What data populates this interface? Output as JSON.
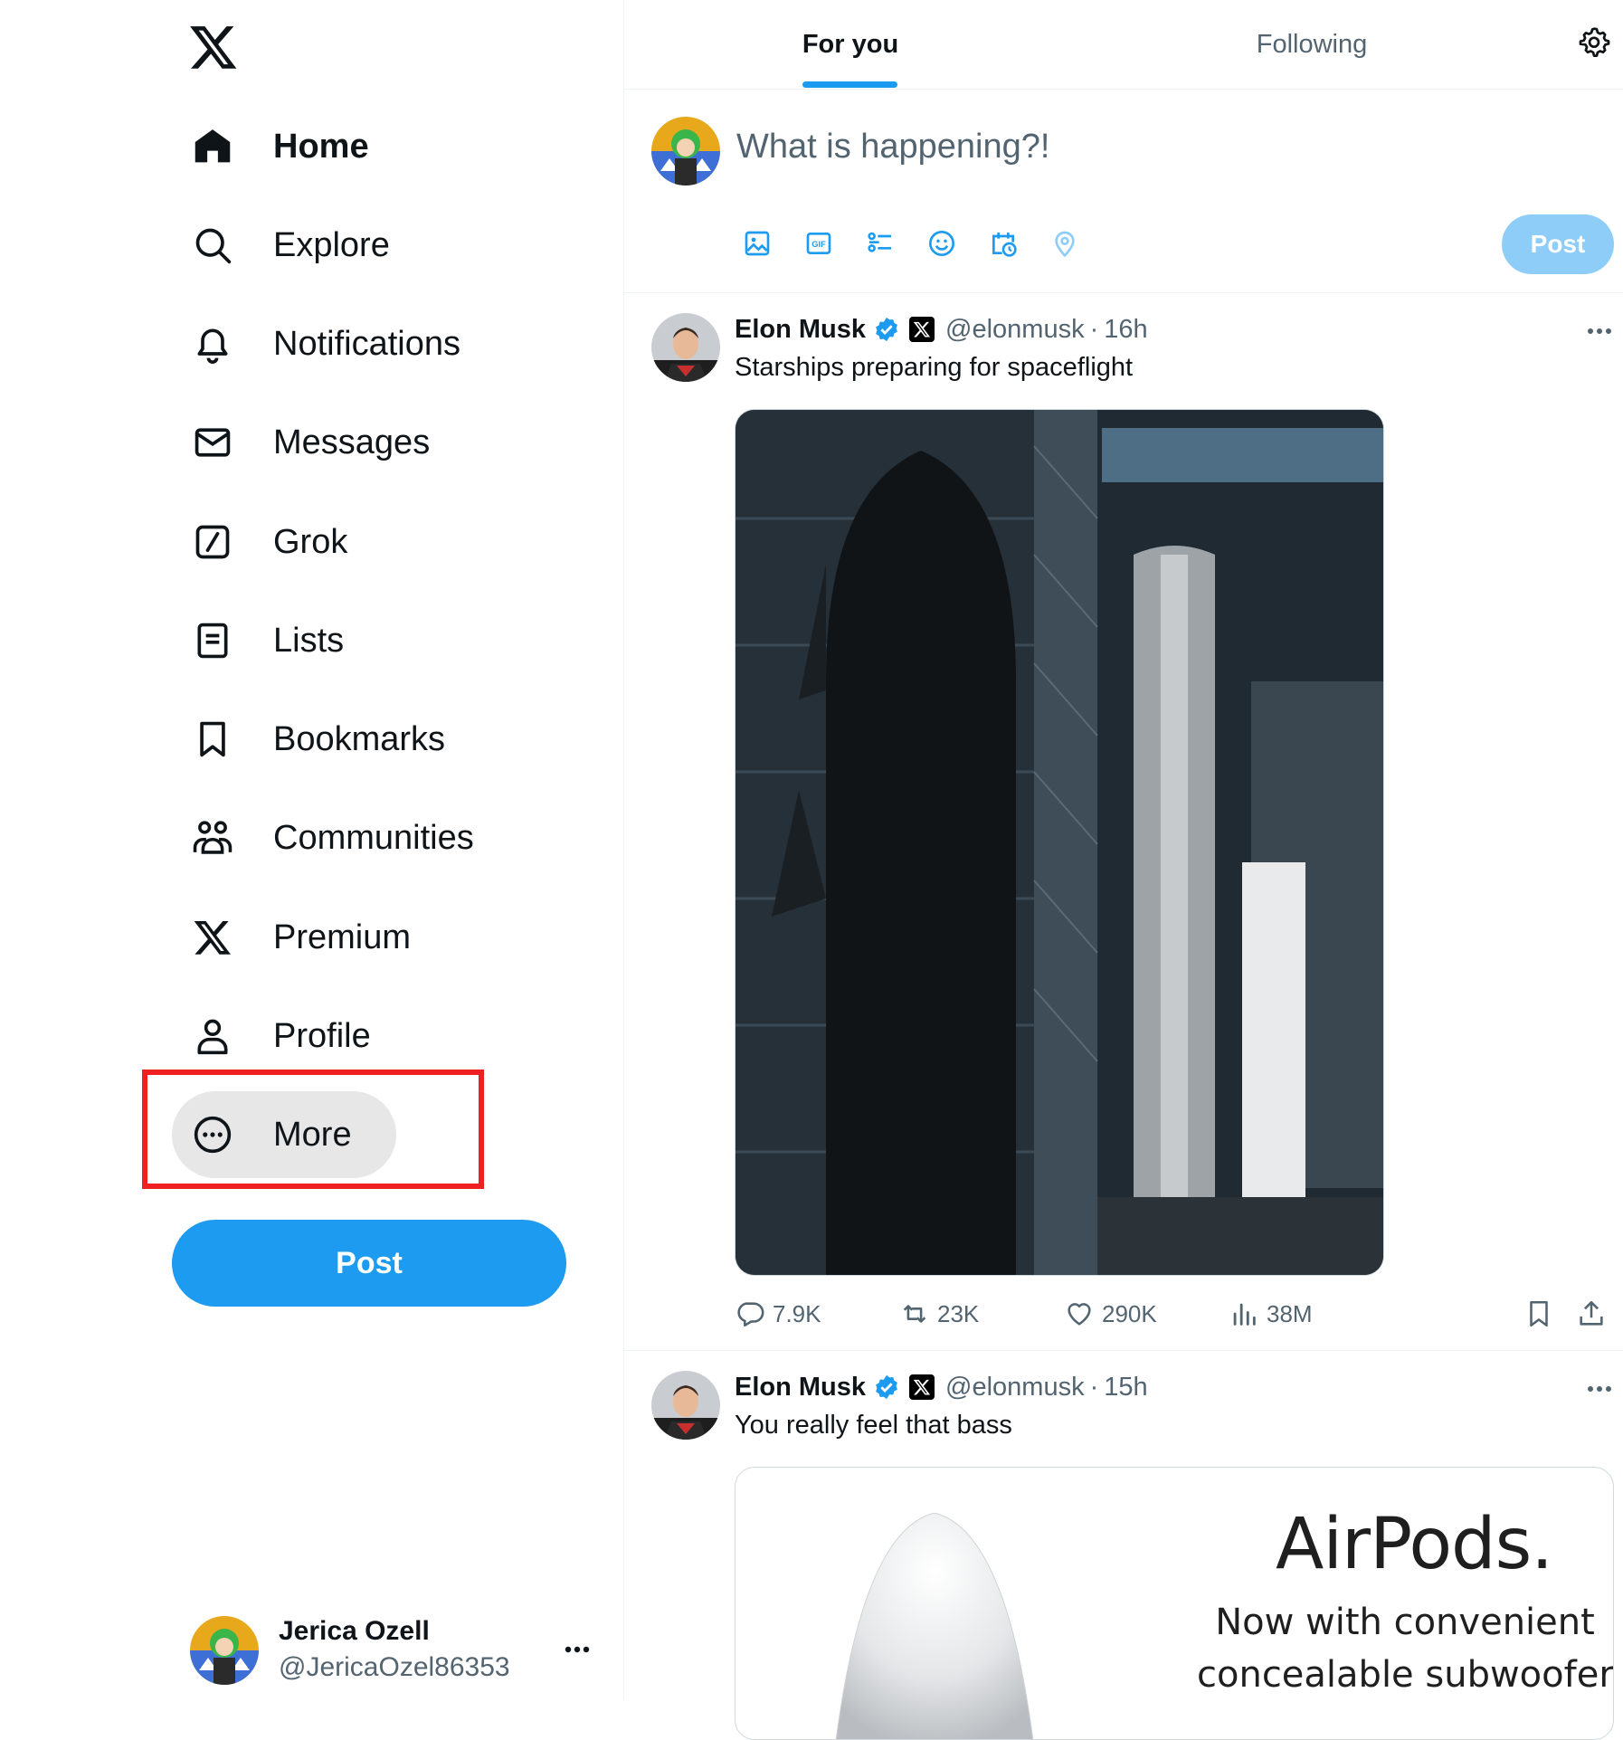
{
  "sidebar": {
    "nav": [
      {
        "label": "Home",
        "icon": "home-icon"
      },
      {
        "label": "Explore",
        "icon": "search-icon"
      },
      {
        "label": "Notifications",
        "icon": "bell-icon"
      },
      {
        "label": "Messages",
        "icon": "envelope-icon"
      },
      {
        "label": "Grok",
        "icon": "grok-icon"
      },
      {
        "label": "Lists",
        "icon": "list-icon"
      },
      {
        "label": "Bookmarks",
        "icon": "bookmark-icon"
      },
      {
        "label": "Communities",
        "icon": "communities-icon"
      },
      {
        "label": "Premium",
        "icon": "x-logo-icon"
      },
      {
        "label": "Profile",
        "icon": "person-icon"
      },
      {
        "label": "More",
        "icon": "more-circle-icon"
      }
    ],
    "post_button": "Post",
    "account": {
      "name": "Jerica Ozell",
      "handle": "@JericaOzel86353"
    }
  },
  "tabs": {
    "for_you": "For you",
    "following": "Following"
  },
  "composer": {
    "placeholder": "What is happening?!",
    "post_button": "Post"
  },
  "tweets": [
    {
      "author": "Elon Musk",
      "handle": "@elonmusk",
      "time": "16h",
      "text": "Starships preparing for spaceflight",
      "stats": {
        "replies": "7.9K",
        "reposts": "23K",
        "likes": "290K",
        "views": "38M"
      }
    },
    {
      "author": "Elon Musk",
      "handle": "@elonmusk",
      "time": "15h",
      "text": "You really feel that bass",
      "image_text": {
        "title": "AirPods.",
        "line1": "Now with convenient",
        "line2": "concealable subwoofer."
      }
    }
  ],
  "separator": "·",
  "colors": {
    "accent": "#1d9bf0",
    "highlight": "#ee2020",
    "muted": "#536471"
  }
}
